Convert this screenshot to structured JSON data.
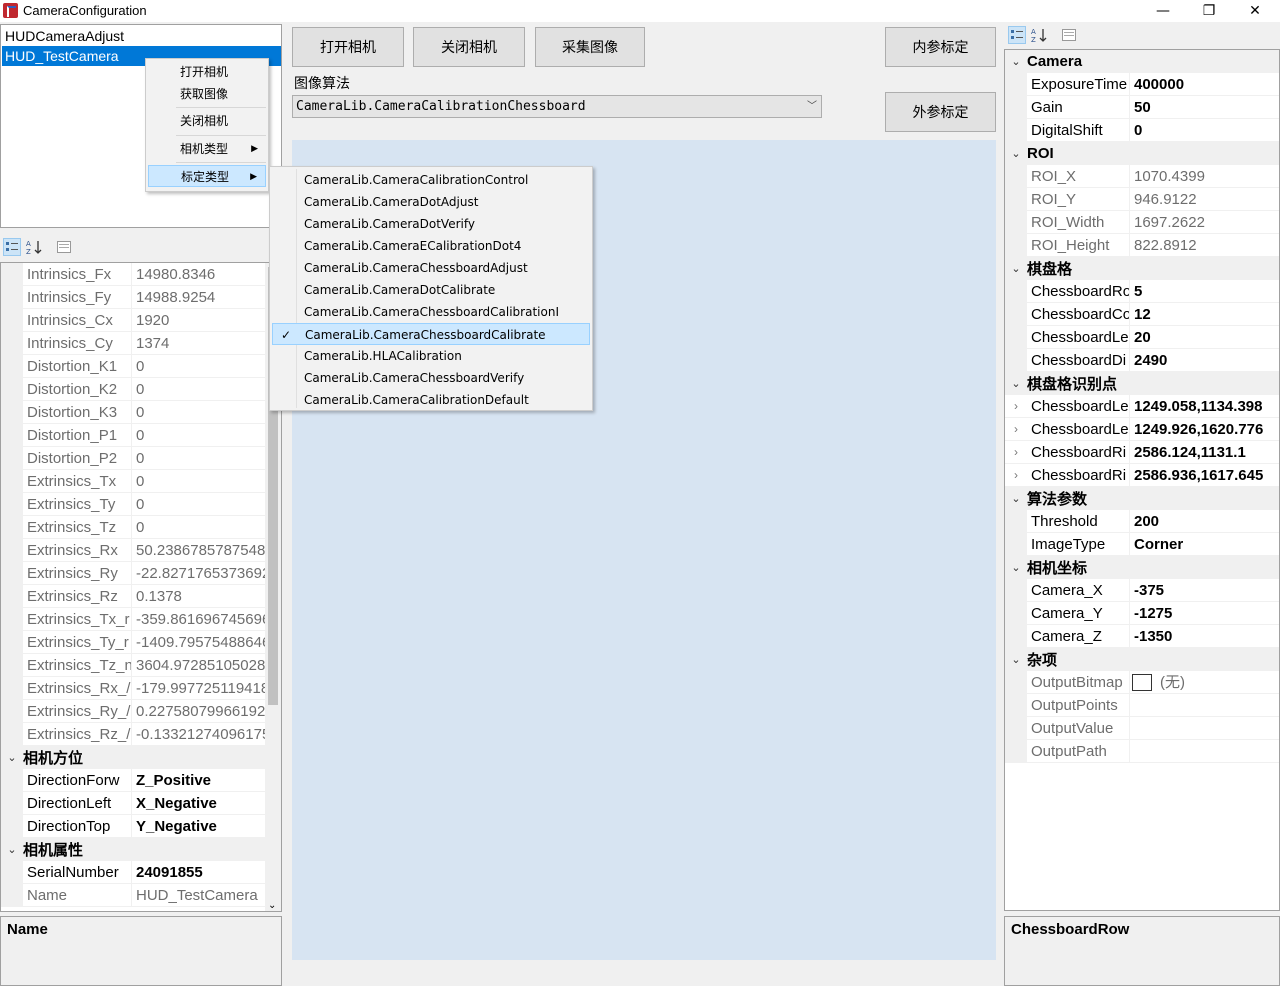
{
  "window": {
    "title": "CameraConfiguration",
    "minimize": "—",
    "maximize": "❐",
    "close": "✕"
  },
  "tree": {
    "items": [
      "HUDCameraAdjust",
      "HUD_TestCamera"
    ]
  },
  "toolbar": {
    "open_camera": "打开相机",
    "close_camera": "关闭相机",
    "capture": "采集图像",
    "intrinsic_calib": "内参标定",
    "extrinsic_calib": "外参标定"
  },
  "algorithm": {
    "label": "图像算法",
    "selected": "CameraLib.CameraCalibrationChessboard"
  },
  "context_menu": {
    "items": [
      "打开相机",
      "获取图像",
      "关闭相机",
      "相机类型",
      "标定类型"
    ]
  },
  "calib_submenu": {
    "items": [
      "CameraLib.CameraCalibrationControl",
      "CameraLib.CameraDotAdjust",
      "CameraLib.CameraDotVerify",
      "CameraLib.CameraECalibrationDot4",
      "CameraLib.CameraChessboardAdjust",
      "CameraLib.CameraDotCalibrate",
      "CameraLib.CameraChessboardCalibrationI",
      "CameraLib.CameraChessboardCalibrate",
      "CameraLib.HLACalibration",
      "CameraLib.CameraChessboardVerify",
      "CameraLib.CameraCalibrationDefault"
    ],
    "checked_index": 7
  },
  "left_grid": {
    "rows": [
      {
        "name": "Intrinsics_Fx",
        "value": "14980.8346"
      },
      {
        "name": "Intrinsics_Fy",
        "value": "14988.9254"
      },
      {
        "name": "Intrinsics_Cx",
        "value": "1920"
      },
      {
        "name": "Intrinsics_Cy",
        "value": "1374"
      },
      {
        "name": "Distortion_K1",
        "value": "0"
      },
      {
        "name": "Distortion_K2",
        "value": "0"
      },
      {
        "name": "Distortion_K3",
        "value": "0"
      },
      {
        "name": "Distortion_P1",
        "value": "0"
      },
      {
        "name": "Distortion_P2",
        "value": "0"
      },
      {
        "name": "Extrinsics_Tx",
        "value": "0"
      },
      {
        "name": "Extrinsics_Ty",
        "value": "0"
      },
      {
        "name": "Extrinsics_Tz",
        "value": "0"
      },
      {
        "name": "Extrinsics_Rx",
        "value": "50.23867857875481"
      },
      {
        "name": "Extrinsics_Ry",
        "value": "-22.8271765373692"
      },
      {
        "name": "Extrinsics_Rz",
        "value": "0.1378"
      },
      {
        "name": "Extrinsics_Tx_r",
        "value": "-359.861696745696"
      },
      {
        "name": "Extrinsics_Ty_r",
        "value": "-1409.79575488646"
      },
      {
        "name": "Extrinsics_Tz_n",
        "value": "3604.972851050288"
      },
      {
        "name": "Extrinsics_Rx_/",
        "value": "-179.997725119418"
      },
      {
        "name": "Extrinsics_Ry_/",
        "value": "0.227580799661928"
      },
      {
        "name": "Extrinsics_Rz_/",
        "value": "-0.13321274096175"
      }
    ],
    "cat_direction": "相机方位",
    "direction_rows": [
      {
        "name": "DirectionForw",
        "value": "Z_Positive"
      },
      {
        "name": "DirectionLeft",
        "value": "X_Negative"
      },
      {
        "name": "DirectionTop",
        "value": "Y_Negative"
      }
    ],
    "cat_props": "相机属性",
    "prop_rows": [
      {
        "name": "SerialNumber",
        "value": "24091855"
      },
      {
        "name": "Name",
        "value": "HUD_TestCamera"
      }
    ],
    "desc_title": "Name"
  },
  "right_grid": {
    "cat_camera": "Camera",
    "camera_rows": [
      {
        "name": "ExposureTime",
        "value": "400000"
      },
      {
        "name": "Gain",
        "value": "50"
      },
      {
        "name": "DigitalShift",
        "value": "0"
      }
    ],
    "cat_roi": "ROI",
    "roi_rows": [
      {
        "name": "ROI_X",
        "value": "1070.4399"
      },
      {
        "name": "ROI_Y",
        "value": "946.9122"
      },
      {
        "name": "ROI_Width",
        "value": "1697.2622"
      },
      {
        "name": "ROI_Height",
        "value": "822.8912"
      }
    ],
    "cat_chessboard": "棋盘格",
    "chessboard_rows": [
      {
        "name": "ChessboardRo",
        "value": "5"
      },
      {
        "name": "ChessboardCo",
        "value": "12"
      },
      {
        "name": "ChessboardLe",
        "value": "20"
      },
      {
        "name": "ChessboardDi",
        "value": "2490"
      }
    ],
    "cat_points": "棋盘格识别点",
    "point_rows": [
      {
        "name": "ChessboardLe",
        "value": "1249.058,1134.398"
      },
      {
        "name": "ChessboardLe",
        "value": "1249.926,1620.776"
      },
      {
        "name": "ChessboardRi",
        "value": "2586.124,1131.1"
      },
      {
        "name": "ChessboardRi",
        "value": "2586.936,1617.645"
      }
    ],
    "cat_algo": "算法参数",
    "algo_rows": [
      {
        "name": "Threshold",
        "value": "200"
      },
      {
        "name": "ImageType",
        "value": "Corner"
      }
    ],
    "cat_coords": "相机坐标",
    "coord_rows": [
      {
        "name": "Camera_X",
        "value": "-375"
      },
      {
        "name": "Camera_Y",
        "value": "-1275"
      },
      {
        "name": "Camera_Z",
        "value": "-1350"
      }
    ],
    "cat_misc": "杂项",
    "misc_rows": [
      {
        "name": "OutputBitmap",
        "value": "(无)"
      },
      {
        "name": "OutputPoints",
        "value": ""
      },
      {
        "name": "OutputValue",
        "value": ""
      },
      {
        "name": "OutputPath",
        "value": ""
      }
    ],
    "desc_title": "ChessboardRow"
  },
  "icons": {
    "categorized": "categorized-icon",
    "alphabetical": "sort-az-icon",
    "property_pages": "property-pages-icon"
  },
  "colors": {
    "selection": "#0078d7",
    "canvas": "#d7e4f2",
    "menu_highlight": "#cce8ff"
  }
}
